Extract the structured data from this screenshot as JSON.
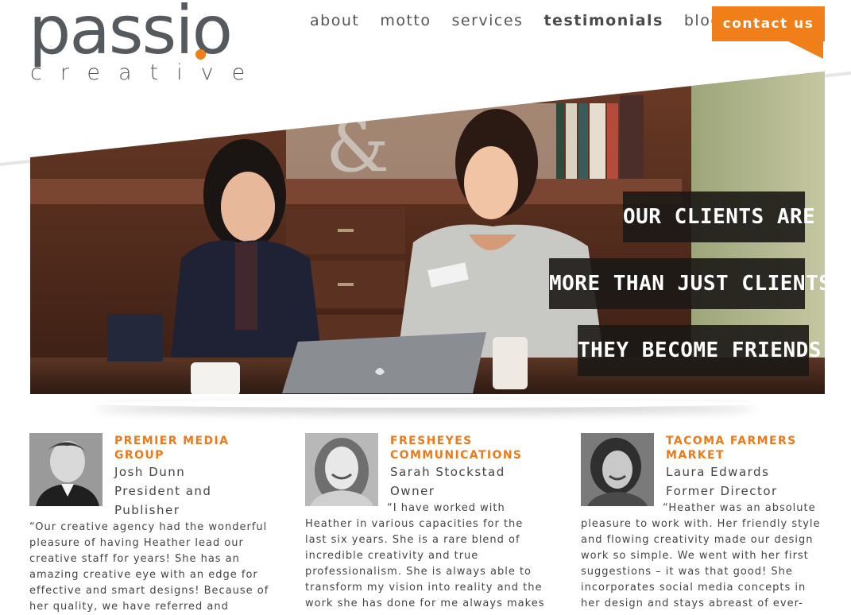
{
  "brand": {
    "logo_word": "passio",
    "logo_sub": "creative",
    "accent_color": "#f07f1a",
    "text_color": "#555a5f"
  },
  "nav": {
    "items": [
      {
        "label": "about"
      },
      {
        "label": "motto"
      },
      {
        "label": "services"
      },
      {
        "label": "testimonials",
        "active": true
      },
      {
        "label": "blog"
      }
    ],
    "contact_label": "contact us"
  },
  "hero": {
    "taglines": [
      "OUR CLIENTS ARE",
      "MORE THAN JUST CLIENTS",
      "THEY BECOME FRIENDS"
    ]
  },
  "testimonials": [
    {
      "company": "PREMIER MEDIA GROUP",
      "name": "Josh Dunn",
      "role": "President and Publisher",
      "quote": "“Our creative agency had the wonderful pleasure of having Heather lead our creative staff for years! She has an amazing creative eye with an edge for effective and smart designs! Because of her quality, we have referred and"
    },
    {
      "company": "FRESHEYES COMMUNICATIONS",
      "name": "Sarah Stockstad",
      "role": "Owner",
      "quote": "“I have worked with Heather in various capacities for the last six years. She is a rare blend of incredible creativity and true professionalism. She is always able to transform my vision into reality and the work she has done for me always makes"
    },
    {
      "company": "TACOMA FARMERS MARKET",
      "name": "Laura Edwards",
      "role": "Former Director",
      "quote": "“Heather was an absolute pleasure to work with. Her friendly style and flowing creativity made our design work so simple. We went with her first suggestions – it was that good! She incorporates social media concepts in her design and stays abreast of ever-"
    }
  ]
}
